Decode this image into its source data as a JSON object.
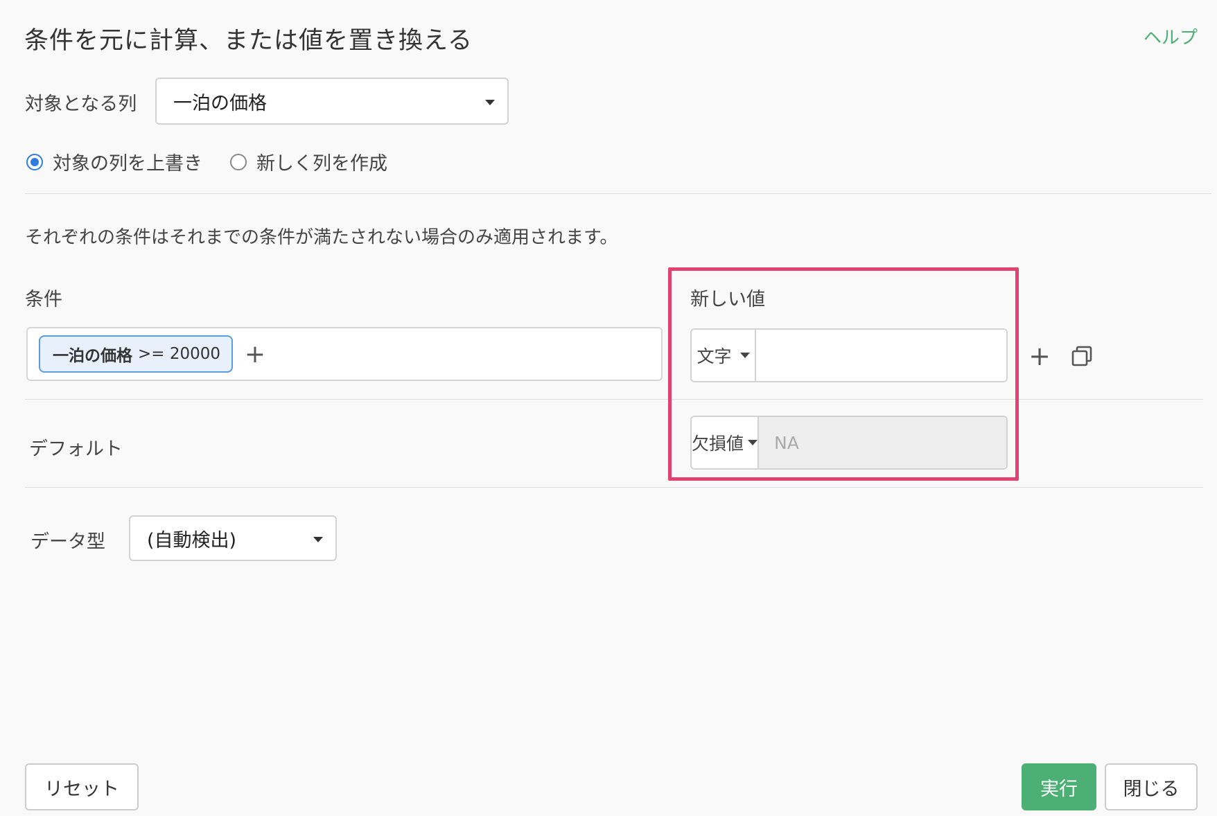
{
  "dialog": {
    "title": "条件を元に計算、または値を置き換える",
    "help_label": "ヘルプ"
  },
  "target_column": {
    "label": "対象となる列",
    "selected": "一泊の価格"
  },
  "output_mode": {
    "options": [
      {
        "label": "対象の列を上書き",
        "checked": true
      },
      {
        "label": "新しく列を作成",
        "checked": false
      }
    ]
  },
  "description": "それぞれの条件はそれまでの条件が満たされない場合のみ適用されます。",
  "conditions": {
    "header": "条件",
    "chip_column": "一泊の価格",
    "chip_expression": ">= 20000"
  },
  "new_value": {
    "header": "新しい値",
    "type_label": "文字",
    "input_value": ""
  },
  "default": {
    "label": "デフォルト",
    "type_label": "欠損値",
    "placeholder": "NA"
  },
  "data_type": {
    "label": "データ型",
    "selected": "(自動検出)"
  },
  "footer": {
    "reset_label": "リセット",
    "run_label": "実行",
    "close_label": "閉じる"
  },
  "colors": {
    "primary": "#4caf74",
    "radio_checked": "#2f7ce0",
    "highlight": "#e0436f",
    "chip_border": "#5b9be0"
  },
  "icons": [
    "caret-down-icon",
    "plus-icon",
    "copy-icon"
  ]
}
